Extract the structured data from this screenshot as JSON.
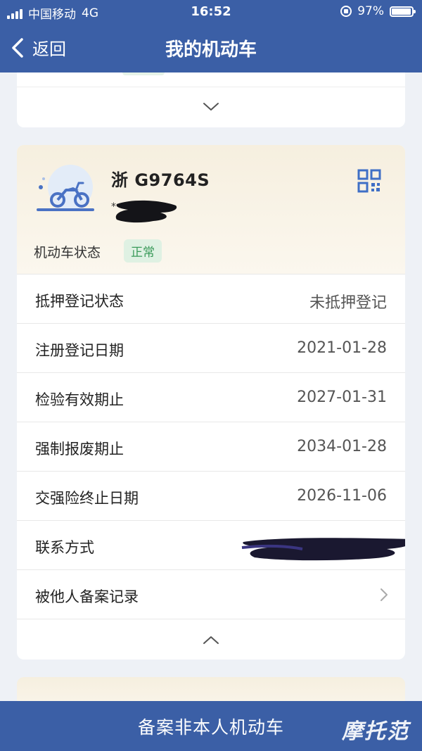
{
  "status_bar": {
    "carrier": "中国移动",
    "network": "4G",
    "time": "16:52",
    "battery": "97%",
    "battery_level": 0.97
  },
  "nav": {
    "back_label": "返回",
    "title": "我的机动车"
  },
  "vehicle": {
    "plate": "浙 G9764S",
    "status_label": "机动车状态",
    "status_badge": "正常",
    "status_color": "#3a9a5a",
    "details": [
      {
        "label": "抵押登记状态",
        "value": "未抵押登记"
      },
      {
        "label": "注册登记日期",
        "value": "2021-01-28"
      },
      {
        "label": "检验有效期止",
        "value": "2027-01-31"
      },
      {
        "label": "强制报废期止",
        "value": "2034-01-28"
      },
      {
        "label": "交强险终止日期",
        "value": "2026-11-06"
      },
      {
        "label": "联系方式",
        "value": ""
      },
      {
        "label": "被他人备案记录",
        "value": ""
      }
    ]
  },
  "bottom": {
    "action_label": "备案非本人机动车",
    "watermark": "摩托范"
  },
  "colors": {
    "brand": "#3b5fa6",
    "card_header": "#f6efdf"
  },
  "icons": [
    "chevron-left-icon",
    "motorcycle-icon",
    "qr-code-icon",
    "chevron-down-icon",
    "chevron-up-icon",
    "chevron-right-icon"
  ]
}
